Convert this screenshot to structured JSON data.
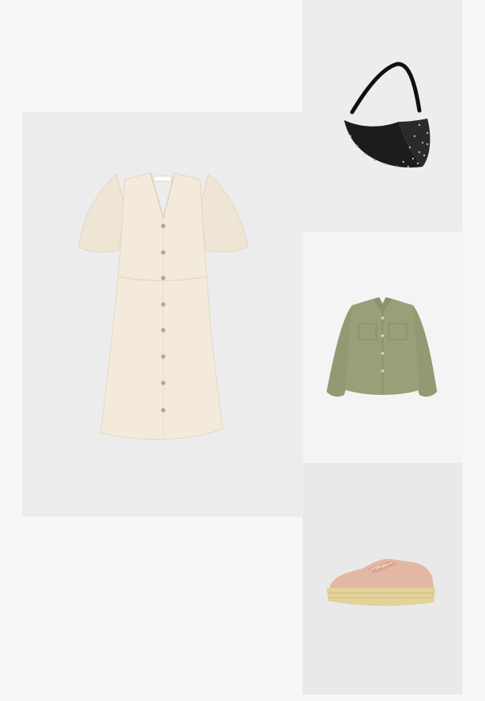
{
  "items": [
    {
      "name": "dress",
      "color": "#f2e9da"
    },
    {
      "name": "handbag",
      "color": "#1c1c1e"
    },
    {
      "name": "jacket",
      "color": "#98a079"
    },
    {
      "name": "sneaker",
      "color": "#e3b7a3"
    }
  ]
}
